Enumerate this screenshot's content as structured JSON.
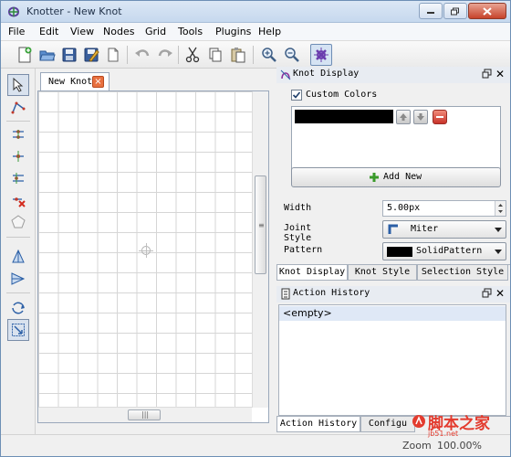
{
  "window": {
    "title": "Knotter - New Knot"
  },
  "menu": [
    "File",
    "Edit",
    "View",
    "Nodes",
    "Grid",
    "Tools",
    "Plugins",
    "Help"
  ],
  "document": {
    "tab_label": "New Knot"
  },
  "knot_display": {
    "title": "Knot Display",
    "custom_colors_label": "Custom Colors",
    "custom_colors_checked": true,
    "color": "#000000",
    "add_new_label": "Add New",
    "width_label": "Width",
    "width_value": "5.00px",
    "joint_style_label": "Joint Style",
    "joint_style_value": "Miter",
    "pattern_label": "Pattern",
    "pattern_value": "SolidPattern",
    "tabs": [
      "Knot Display",
      "Knot Style",
      "Selection Style"
    ]
  },
  "action_history": {
    "title": "Action History",
    "items": [
      "<empty>"
    ],
    "tabs": [
      "Action History",
      "Configu"
    ]
  },
  "status": {
    "zoom_value": "100.00%",
    "zoom_partial": "Zoom"
  },
  "watermark": {
    "text": "脚本之家",
    "subtext": "jb51.net"
  }
}
